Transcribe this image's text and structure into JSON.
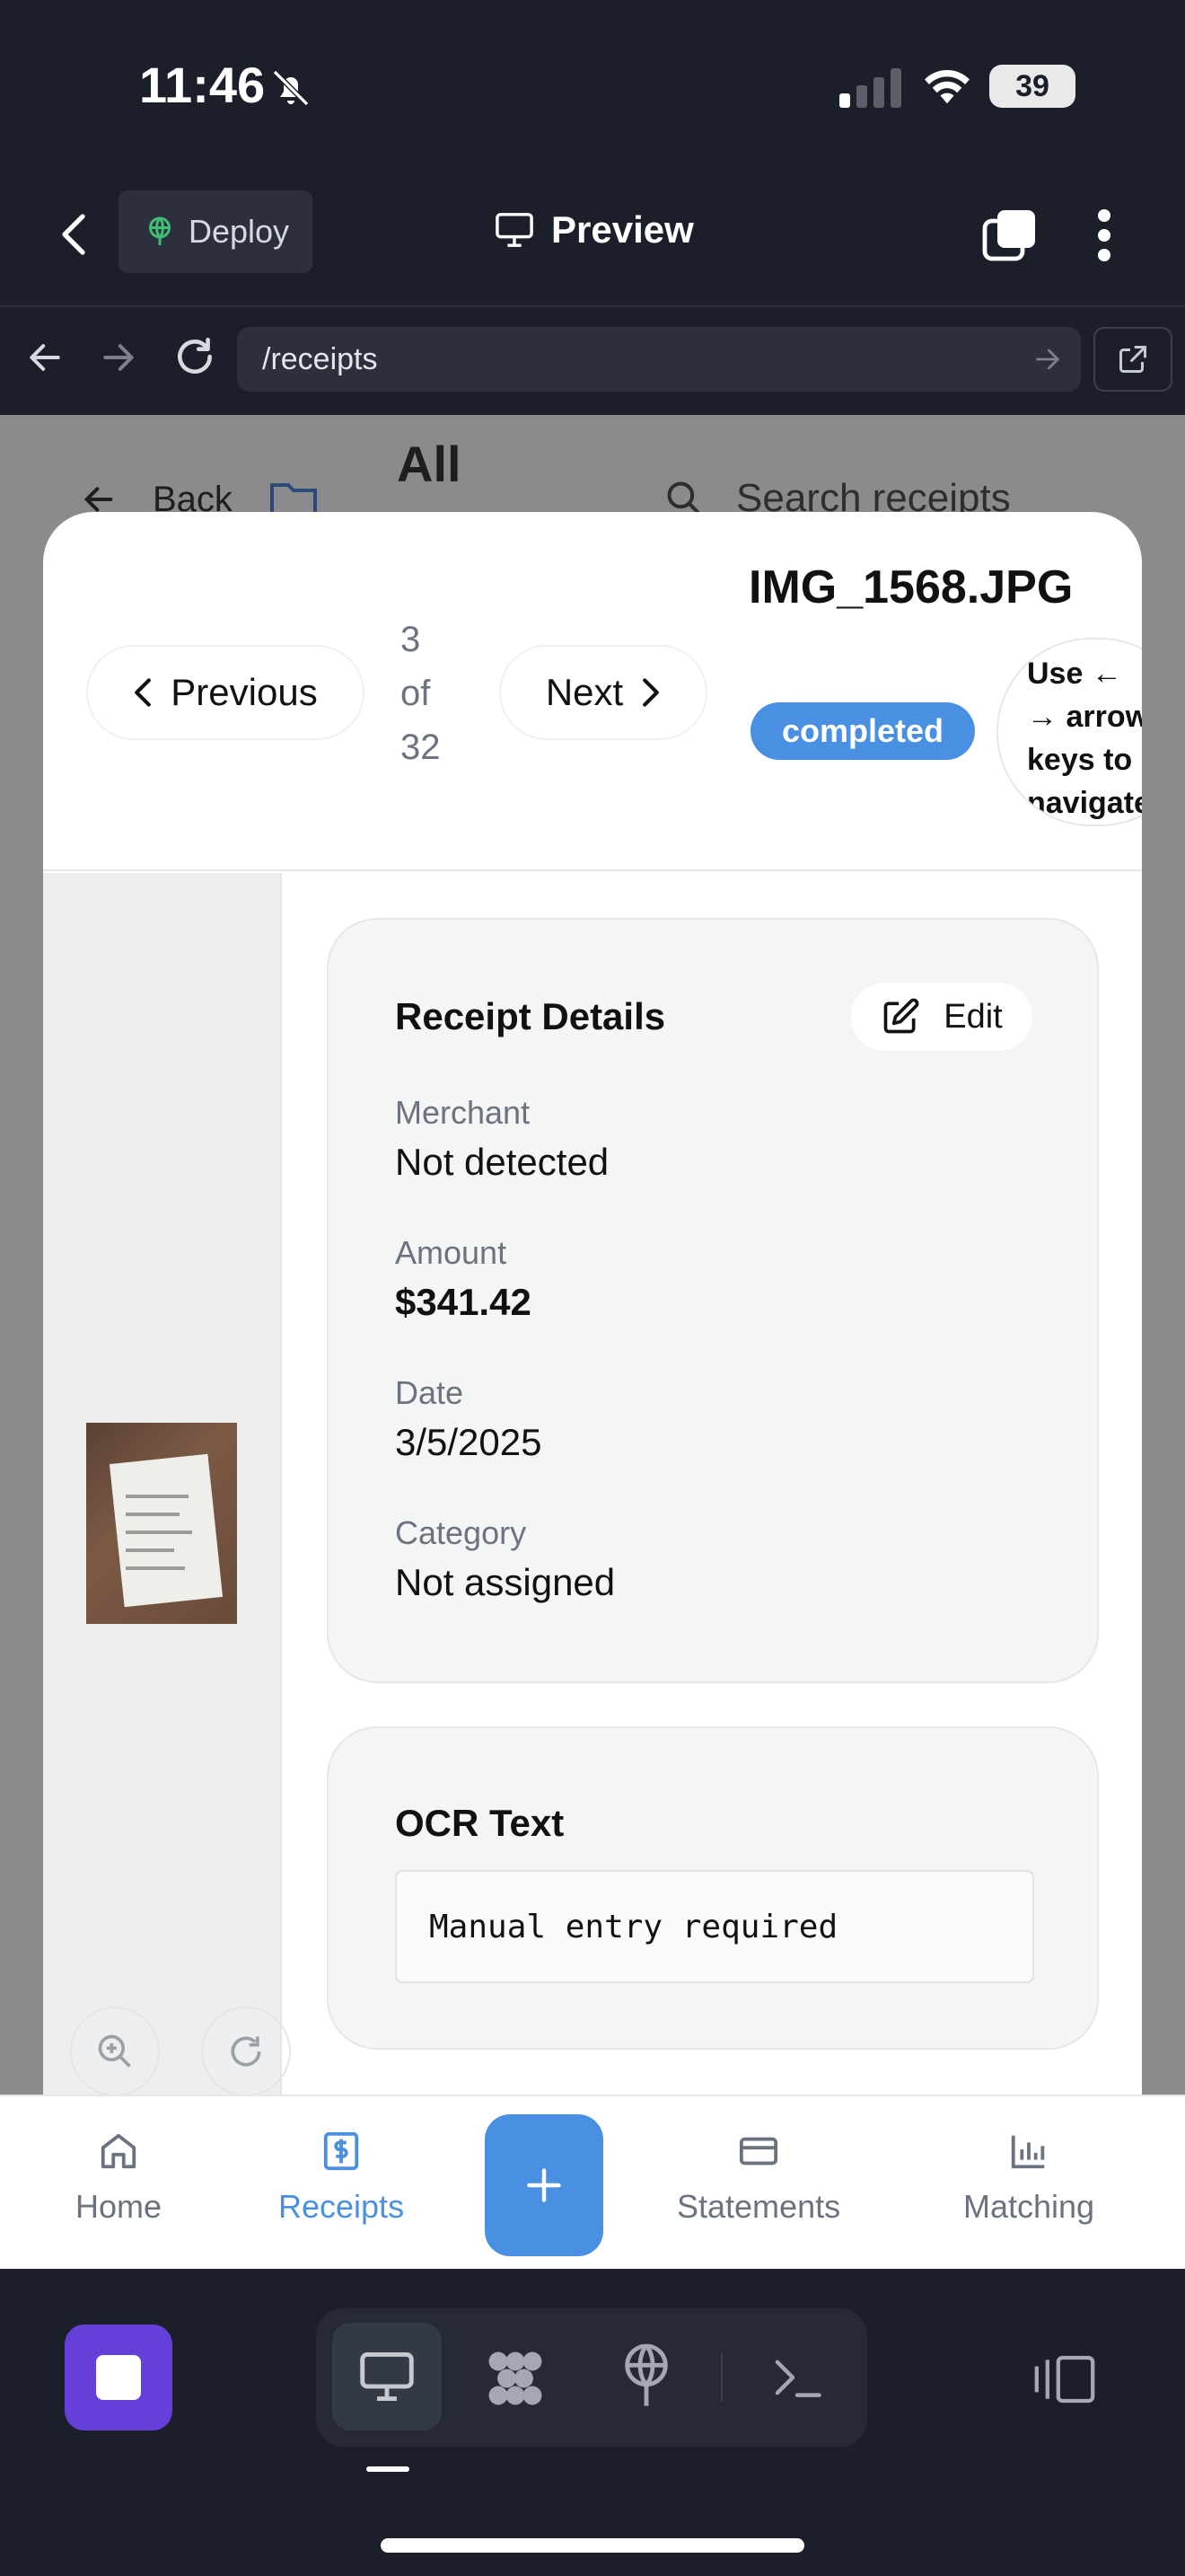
{
  "status_bar": {
    "time": "11:46",
    "battery": "39"
  },
  "app_header": {
    "deploy_label": "Deploy",
    "preview_label": "Preview"
  },
  "browser": {
    "url": "/receipts"
  },
  "background_page": {
    "back_label": "Back",
    "folder_title": "All",
    "search_placeholder": "Search receipts"
  },
  "modal": {
    "previous_label": "Previous",
    "counter": {
      "current": "3",
      "of": "of",
      "total": "32"
    },
    "next_label": "Next",
    "filename": "IMG_1568.JPG",
    "status": "completed",
    "hint_lines": [
      "Use ←",
      "→ arrow",
      "keys to",
      "navigate"
    ],
    "details": {
      "title": "Receipt Details",
      "edit_label": "Edit",
      "fields": [
        {
          "label": "Merchant",
          "value": "Not detected"
        },
        {
          "label": "Amount",
          "value": "$341.42"
        },
        {
          "label": "Date",
          "value": "3/5/2025"
        },
        {
          "label": "Category",
          "value": "Not assigned"
        }
      ]
    },
    "ocr": {
      "title": "OCR Text",
      "text": "Manual entry required"
    }
  },
  "tab_bar": {
    "items": [
      {
        "label": "Home",
        "icon": "home-icon",
        "active": false
      },
      {
        "label": "Receipts",
        "icon": "receipt-icon",
        "active": true
      },
      {
        "label": "Statements",
        "icon": "card-icon",
        "active": false
      },
      {
        "label": "Matching",
        "icon": "chart-icon",
        "active": false
      }
    ],
    "fab_icon": "plus-icon"
  },
  "colors": {
    "accent": "#4a90e2",
    "dark_bg": "#1b1f2a",
    "stop_button": "#6540d8"
  }
}
